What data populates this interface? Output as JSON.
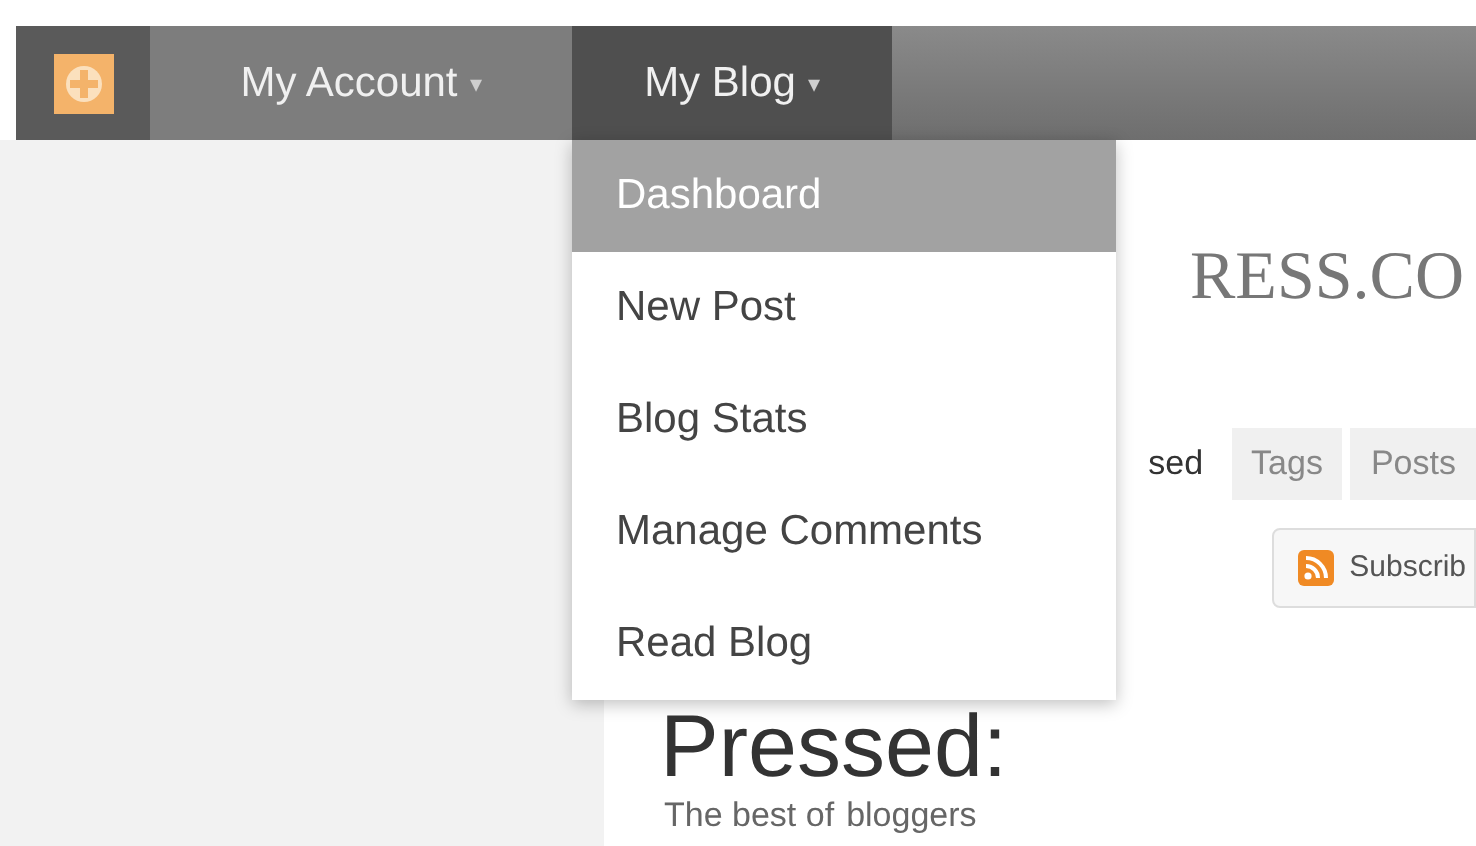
{
  "admin_bar": {
    "menus": [
      {
        "label": "My Account",
        "caret": "▾",
        "selected": false
      },
      {
        "label": "My Blog",
        "caret": "▾",
        "selected": true
      }
    ]
  },
  "dropdown": {
    "items": [
      {
        "label": "Dashboard",
        "selected": true
      },
      {
        "label": "New Post",
        "selected": false
      },
      {
        "label": "Blog Stats",
        "selected": false
      },
      {
        "label": "Manage Comments",
        "selected": false
      },
      {
        "label": "Read Blog",
        "selected": false
      }
    ]
  },
  "page": {
    "site_title": "RESS.CO",
    "tabs": [
      {
        "label": "sed",
        "selected": true
      },
      {
        "label": "Tags",
        "selected": false
      },
      {
        "label": "Posts",
        "selected": false
      }
    ],
    "subscribe_button": "Subscrib",
    "heading": "Pressed:",
    "subtitle": "The best of",
    "subtitle_end": "bloggers"
  }
}
